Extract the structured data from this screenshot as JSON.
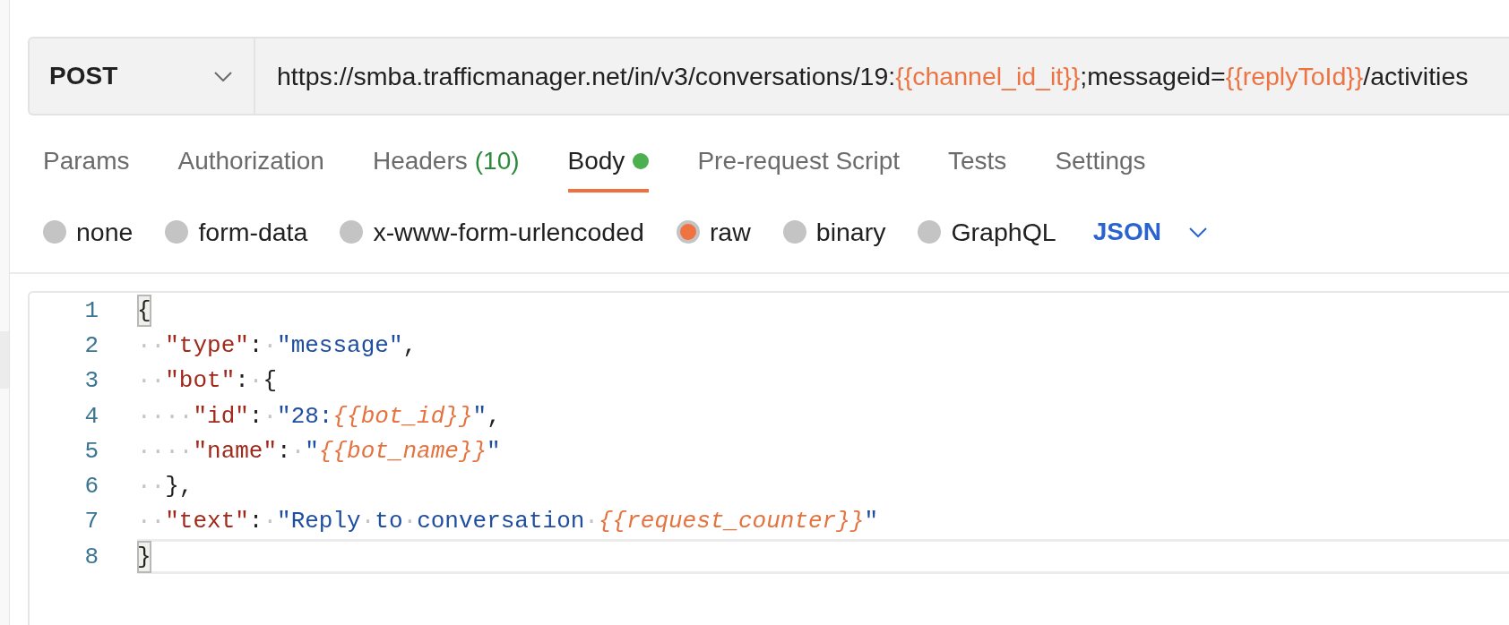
{
  "request": {
    "method": "POST",
    "url": [
      {
        "kind": "text",
        "text": "https://smba.trafficmanager.net/in/v3/conversations/19:"
      },
      {
        "kind": "variable",
        "text": "{{channel_id_it}}"
      },
      {
        "kind": "text",
        "text": ";messageid="
      },
      {
        "kind": "variable",
        "text": "{{replyToId}}"
      },
      {
        "kind": "text",
        "text": "/activities"
      }
    ]
  },
  "tabs": [
    {
      "label": "Params",
      "selected": false,
      "indicator": false
    },
    {
      "label": "Authorization",
      "selected": false,
      "indicator": false
    },
    {
      "label": "Headers",
      "count": "(10)",
      "selected": false,
      "indicator": false
    },
    {
      "label": "Body",
      "selected": true,
      "indicator": true
    },
    {
      "label": "Pre-request Script",
      "selected": false,
      "indicator": false
    },
    {
      "label": "Tests",
      "selected": false,
      "indicator": false
    },
    {
      "label": "Settings",
      "selected": false,
      "indicator": false
    }
  ],
  "body_types": [
    {
      "label": "none",
      "selected": false
    },
    {
      "label": "form-data",
      "selected": false
    },
    {
      "label": "x-www-form-urlencoded",
      "selected": false
    },
    {
      "label": "raw",
      "selected": true
    },
    {
      "label": "binary",
      "selected": false
    },
    {
      "label": "GraphQL",
      "selected": false
    }
  ],
  "format": {
    "value": "JSON"
  },
  "editor": {
    "lines": [
      {
        "number": "1",
        "active": false,
        "tokens": [
          {
            "kind": "bracket_match",
            "text": "{"
          }
        ]
      },
      {
        "number": "2",
        "active": false,
        "tokens": [
          {
            "kind": "space",
            "text": "··"
          },
          {
            "kind": "key",
            "text": "\"type\""
          },
          {
            "kind": "punct",
            "text": ":"
          },
          {
            "kind": "space",
            "text": "·"
          },
          {
            "kind": "string",
            "text": "\"message\""
          },
          {
            "kind": "punct",
            "text": ","
          }
        ]
      },
      {
        "number": "3",
        "active": false,
        "tokens": [
          {
            "kind": "space",
            "text": "··"
          },
          {
            "kind": "key",
            "text": "\"bot\""
          },
          {
            "kind": "punct",
            "text": ":"
          },
          {
            "kind": "space",
            "text": "·"
          },
          {
            "kind": "punct",
            "text": "{"
          }
        ]
      },
      {
        "number": "4",
        "active": false,
        "tokens": [
          {
            "kind": "space",
            "text": "····"
          },
          {
            "kind": "key",
            "text": "\"id\""
          },
          {
            "kind": "punct",
            "text": ":"
          },
          {
            "kind": "space",
            "text": "·"
          },
          {
            "kind": "string",
            "text": "\"28:"
          },
          {
            "kind": "variable",
            "text": "{{bot_id}}"
          },
          {
            "kind": "string",
            "text": "\""
          },
          {
            "kind": "punct",
            "text": ","
          }
        ]
      },
      {
        "number": "5",
        "active": false,
        "tokens": [
          {
            "kind": "space",
            "text": "····"
          },
          {
            "kind": "key",
            "text": "\"name\""
          },
          {
            "kind": "punct",
            "text": ":"
          },
          {
            "kind": "space",
            "text": "·"
          },
          {
            "kind": "string",
            "text": "\""
          },
          {
            "kind": "variable",
            "text": "{{bot_name}}"
          },
          {
            "kind": "string",
            "text": "\""
          }
        ]
      },
      {
        "number": "6",
        "active": false,
        "tokens": [
          {
            "kind": "space",
            "text": "··"
          },
          {
            "kind": "punct",
            "text": "},"
          }
        ]
      },
      {
        "number": "7",
        "active": false,
        "tokens": [
          {
            "kind": "space",
            "text": "··"
          },
          {
            "kind": "key",
            "text": "\"text\""
          },
          {
            "kind": "punct",
            "text": ":"
          },
          {
            "kind": "space",
            "text": "·"
          },
          {
            "kind": "string",
            "text": "\"Reply"
          },
          {
            "kind": "space",
            "text": "·"
          },
          {
            "kind": "string",
            "text": "to"
          },
          {
            "kind": "space",
            "text": "·"
          },
          {
            "kind": "string",
            "text": "conversation"
          },
          {
            "kind": "space",
            "text": "·"
          },
          {
            "kind": "variable",
            "text": "{{request_counter}}"
          },
          {
            "kind": "string",
            "text": "\""
          }
        ]
      },
      {
        "number": "8",
        "active": true,
        "tokens": [
          {
            "kind": "bracket_match",
            "text": "}"
          }
        ]
      }
    ]
  }
}
